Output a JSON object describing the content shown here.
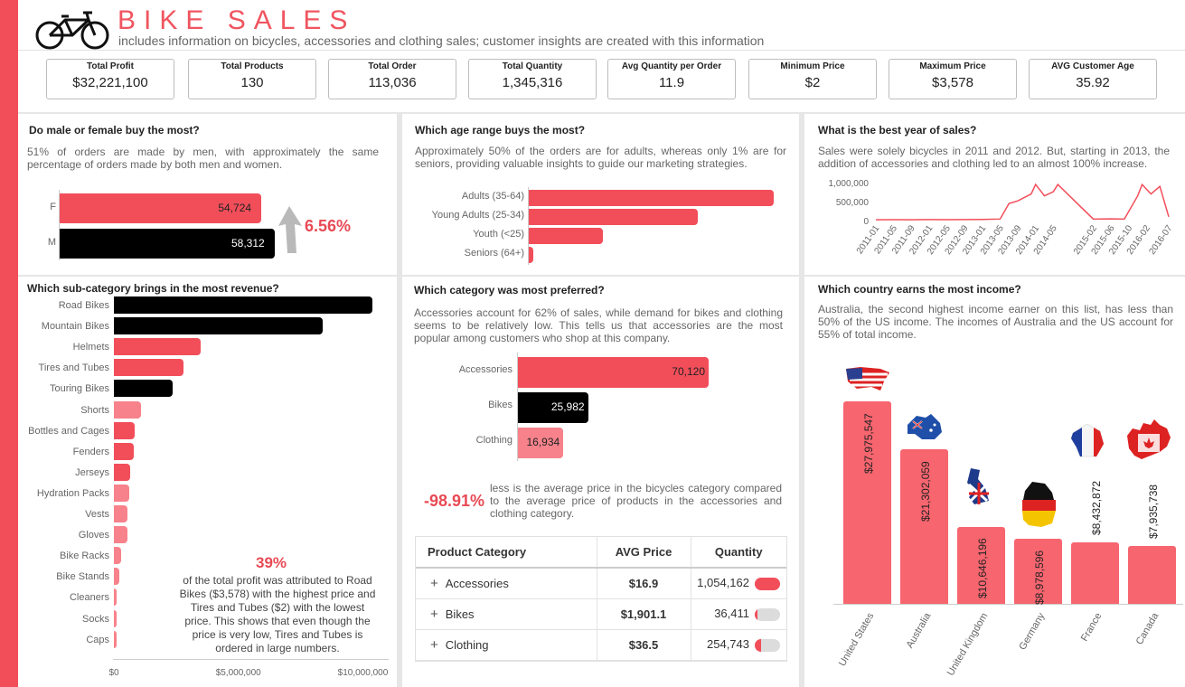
{
  "header": {
    "title": "BIKE SALES",
    "subtitle": "includes information on bicycles, accessories and clothing sales; customer insights are created with this information"
  },
  "colors": {
    "accent": "#f24e5a",
    "light_accent": "#f7828b",
    "dark": "#000000"
  },
  "kpis": [
    {
      "label": "Total Profit",
      "value": "$32,221,100"
    },
    {
      "label": "Total Products",
      "value": "130"
    },
    {
      "label": "Total Order",
      "value": "113,036"
    },
    {
      "label": "Total Quantity",
      "value": "1,345,316"
    },
    {
      "label": "Avg Quantity per Order",
      "value": "11.9"
    },
    {
      "label": "Minimum Price",
      "value": "$2"
    },
    {
      "label": "Maximum Price",
      "value": "$3,578"
    },
    {
      "label": "AVG Customer Age",
      "value": "35.92"
    }
  ],
  "gender": {
    "question": "Do male or female buy the most?",
    "text": "51% of orders are made by men, with approximately the same percentage of orders made by both men and women.",
    "pct": "6.56%",
    "chart_data": {
      "type": "bar",
      "categories": [
        "F",
        "M"
      ],
      "values": [
        54724,
        58312
      ],
      "labels": [
        "54,724",
        "58,312"
      ]
    }
  },
  "age": {
    "question": "Which age range buys the most?",
    "text": "Approximately 50% of the orders are for adults, whereas only 1% are for seniors, providing valuable insights to guide our marketing strategies.",
    "chart_data": {
      "type": "bar",
      "categories": [
        "Adults (35-64)",
        "Young Adults (25-34)",
        "Youth (<25)",
        "Seniors (64+)"
      ],
      "values": [
        55800,
        38600,
        17000,
        1200
      ]
    }
  },
  "year": {
    "question": "What is the best year of sales?",
    "text": "Sales were solely bicycles in 2011 and 2012. But, starting in 2013, the addition of accessories and clothing led to an almost 100% increase.",
    "chart_data": {
      "type": "line",
      "y_ticks": [
        "1,000,000",
        "500,000",
        "0"
      ],
      "ylim": [
        0,
        1000000
      ],
      "x_ticks": [
        "2011-01",
        "2011-05",
        "2011-09",
        "2012-01",
        "2012-05",
        "2012-09",
        "2013-01",
        "2013-05",
        "2013-09",
        "2014-01",
        "2014-05",
        "2015-02",
        "2015-06",
        "2015-10",
        "2016-02",
        "2016-07"
      ],
      "x": [
        "2011-01",
        "2011-05",
        "2011-09",
        "2012-01",
        "2012-05",
        "2012-09",
        "2013-01",
        "2013-05",
        "2013-07",
        "2013-09",
        "2013-12",
        "2014-01",
        "2014-03",
        "2014-05",
        "2014-06",
        "2015-02",
        "2015-06",
        "2015-09",
        "2015-12",
        "2016-01",
        "2016-03",
        "2016-05",
        "2016-07"
      ],
      "y": [
        20000,
        25000,
        22000,
        28000,
        24000,
        26000,
        30000,
        40000,
        450000,
        520000,
        700000,
        950000,
        650000,
        760000,
        950000,
        40000,
        45000,
        40000,
        650000,
        950000,
        700000,
        900000,
        100000
      ]
    }
  },
  "subcat": {
    "question": "Which sub-category brings in the most revenue?",
    "pct": "39%",
    "text": "of the total profit was attributed to Road Bikes ($3,578) with the highest price and Tires and Tubes ($2) with the lowest price. This shows that even though the price is very low, Tires and Tubes is ordered in large numbers.",
    "chart_data": {
      "type": "bar",
      "categories": [
        "Road Bikes",
        "Mountain Bikes",
        "Helmets",
        "Tires and Tubes",
        "Touring Bikes",
        "Shorts",
        "Bottles and Cages",
        "Fenders",
        "Jerseys",
        "Hydration Packs",
        "Vests",
        "Gloves",
        "Bike Racks",
        "Bike Stands",
        "Cleaners",
        "Socks",
        "Caps"
      ],
      "values": [
        10400000,
        8400000,
        3500000,
        2800000,
        2350000,
        1100000,
        850000,
        800000,
        650000,
        600000,
        550000,
        550000,
        300000,
        200000,
        120000,
        90000,
        70000
      ],
      "x_ticks": [
        "$0",
        "$5,000,000",
        "$10,000,000"
      ],
      "xlim": [
        0,
        11000000
      ]
    }
  },
  "category": {
    "question": "Which category was most preferred?",
    "text": "Accessories account for 62% of sales, while demand for bikes and clothing seems to be relatively low. This tells us that accessories are the most popular among customers who shop at this company.",
    "chart_data": {
      "type": "bar",
      "categories": [
        "Accessories",
        "Bikes",
        "Clothing"
      ],
      "values": [
        70120,
        25982,
        16934
      ],
      "labels": [
        "70,120",
        "25,982",
        "16,934"
      ]
    },
    "price_pct": "-98.91%",
    "price_text": "less is the average price in the bicycles category compared to the average price of products in the accessories and clothing category.",
    "table": {
      "headers": [
        "Product Category",
        "AVG Price",
        "Quantity"
      ],
      "rows": [
        {
          "name": "Accessories",
          "price": "$16.9",
          "qty": "1,054,162",
          "share": 1.0
        },
        {
          "name": "Bikes",
          "price": "$1,901.1",
          "qty": "36,411",
          "share": 0.03
        },
        {
          "name": "Clothing",
          "price": "$36.5",
          "qty": "254,743",
          "share": 0.24
        }
      ]
    }
  },
  "country": {
    "question": "Which country earns the most income?",
    "text": "Australia, the second highest income earner on this list, has less than 50% of the US income. The incomes of Australia and the US account for 55% of total income.",
    "chart_data": {
      "type": "bar",
      "categories": [
        "United States",
        "Australia",
        "United Kingdom",
        "Germany",
        "France",
        "Canada"
      ],
      "values": [
        27975547,
        21302059,
        10646196,
        8978596,
        8432872,
        7935738
      ],
      "labels": [
        "$27,975,547",
        "$21,302,059",
        "$10,646,196",
        "$8,978,596",
        "$8,432,872",
        "$7,935,738"
      ]
    }
  }
}
